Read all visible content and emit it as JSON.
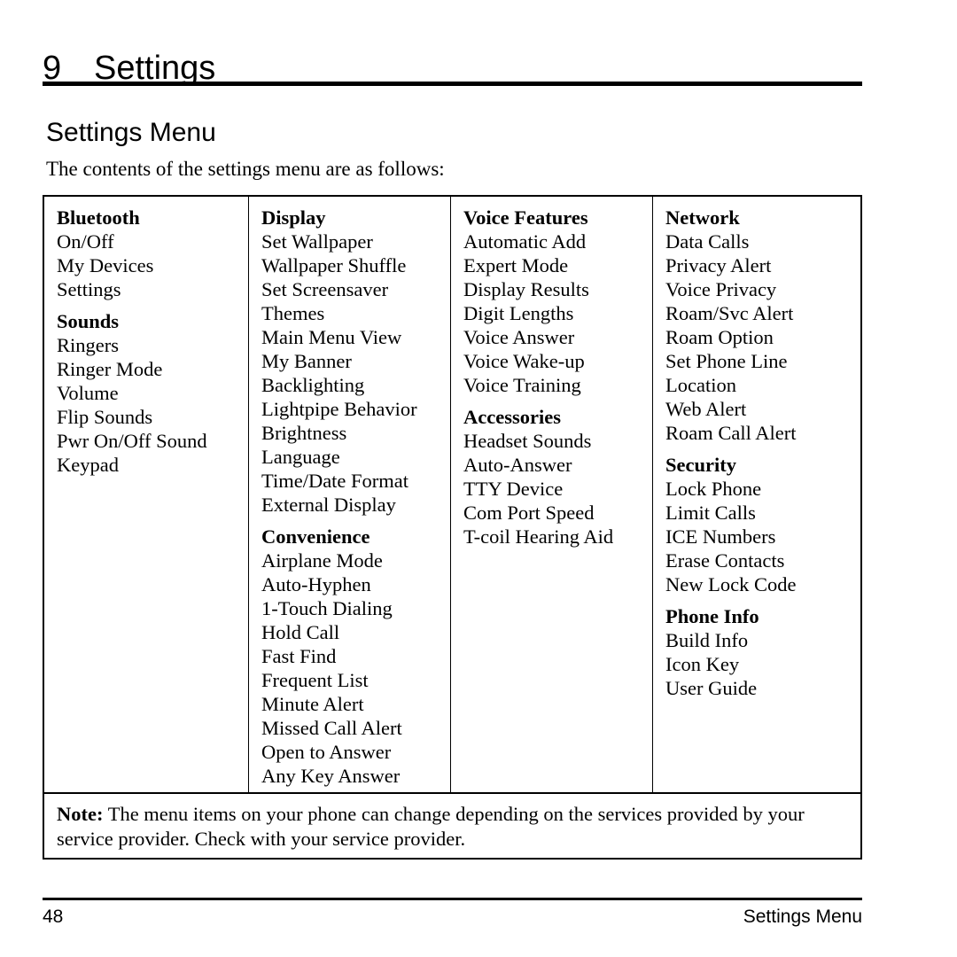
{
  "chapter": {
    "number": "9",
    "title": "Settings"
  },
  "section": {
    "title": "Settings Menu",
    "intro": "The contents of the settings menu are as follows:"
  },
  "table": {
    "columns": [
      {
        "groups": [
          {
            "heading": "Bluetooth",
            "items": [
              "On/Off",
              "My Devices",
              "Settings"
            ]
          },
          {
            "heading": "Sounds",
            "items": [
              "Ringers",
              "Ringer Mode",
              "Volume",
              "Flip Sounds",
              "Pwr On/Off Sound",
              "Keypad"
            ]
          }
        ]
      },
      {
        "groups": [
          {
            "heading": "Display",
            "items": [
              "Set Wallpaper",
              "Wallpaper Shuffle",
              "Set Screensaver",
              "Themes",
              "Main Menu View",
              "My Banner",
              "Backlighting",
              "Lightpipe Behavior",
              "Brightness",
              "Language",
              "Time/Date Format",
              "External Display"
            ]
          },
          {
            "heading": "Convenience",
            "items": [
              "Airplane Mode",
              "Auto-Hyphen",
              "1-Touch Dialing",
              "Hold Call",
              "Fast Find",
              "Frequent List",
              "Minute Alert",
              "Missed Call Alert",
              "Open to Answer",
              "Any Key Answer"
            ]
          }
        ]
      },
      {
        "groups": [
          {
            "heading": "Voice Features",
            "items": [
              "Automatic Add",
              "Expert Mode",
              "Display Results",
              "Digit Lengths",
              "Voice Answer",
              "Voice Wake-up",
              "Voice Training"
            ]
          },
          {
            "heading": "Accessories",
            "items": [
              "Headset Sounds",
              "Auto-Answer",
              "TTY Device",
              "Com Port Speed",
              "T-coil Hearing Aid"
            ]
          }
        ]
      },
      {
        "groups": [
          {
            "heading": "Network",
            "items": [
              "Data Calls",
              "Privacy Alert",
              "Voice Privacy",
              "Roam/Svc Alert",
              "Roam Option",
              "Set Phone Line",
              "Location",
              "Web Alert",
              "Roam Call Alert"
            ]
          },
          {
            "heading": "Security",
            "items": [
              "Lock Phone",
              "Limit Calls",
              "ICE Numbers",
              "Erase Contacts",
              "New Lock Code"
            ]
          },
          {
            "heading": "Phone Info",
            "items": [
              "Build Info",
              "Icon Key",
              "User Guide"
            ]
          }
        ]
      }
    ],
    "note": {
      "label": "Note:",
      "text": " The menu items on your phone can change depending on the services provided by your service provider. Check with your service provider."
    }
  },
  "footer": {
    "page_number": "48",
    "running_title": "Settings Menu"
  }
}
